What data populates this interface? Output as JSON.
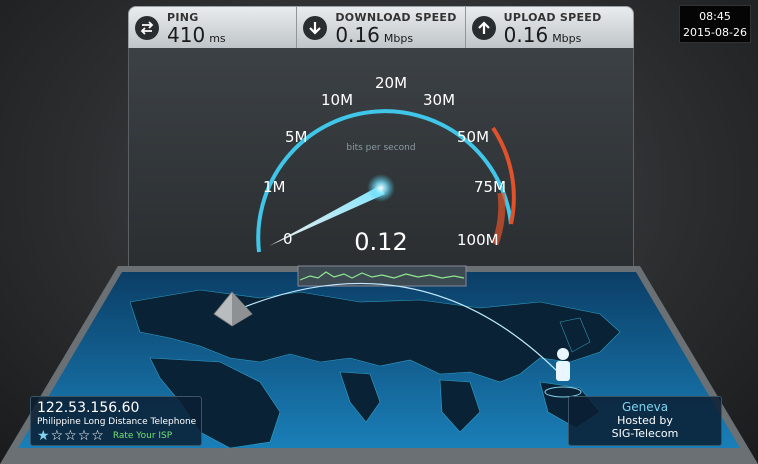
{
  "stats": {
    "ping": {
      "label": "PING",
      "value": "410",
      "unit": "ms",
      "icon": "ping-arrows-icon"
    },
    "download": {
      "label": "DOWNLOAD SPEED",
      "value": "0.16",
      "unit": "Mbps",
      "icon": "download-arrow-icon"
    },
    "upload": {
      "label": "UPLOAD SPEED",
      "value": "0.16",
      "unit": "Mbps",
      "icon": "upload-arrow-icon"
    }
  },
  "clock": {
    "time": "08:45",
    "date": "2015-08-26"
  },
  "gauge": {
    "caption": "bits per second",
    "reading": "0.12",
    "ticks": [
      "0",
      "1M",
      "5M",
      "10M",
      "20M",
      "30M",
      "50M",
      "75M",
      "100M"
    ],
    "accent": "#3fc6e8",
    "warning": "#e0532a"
  },
  "server": {
    "ip": "122.53.156.60",
    "isp": "Philippine Long Distance Telephone",
    "rating": 1,
    "max_rating": 5,
    "rate_label": "Rate Your ISP"
  },
  "host": {
    "city": "Geneva",
    "hosted_by": "Hosted by",
    "sponsor": "SIG-Telecom"
  }
}
